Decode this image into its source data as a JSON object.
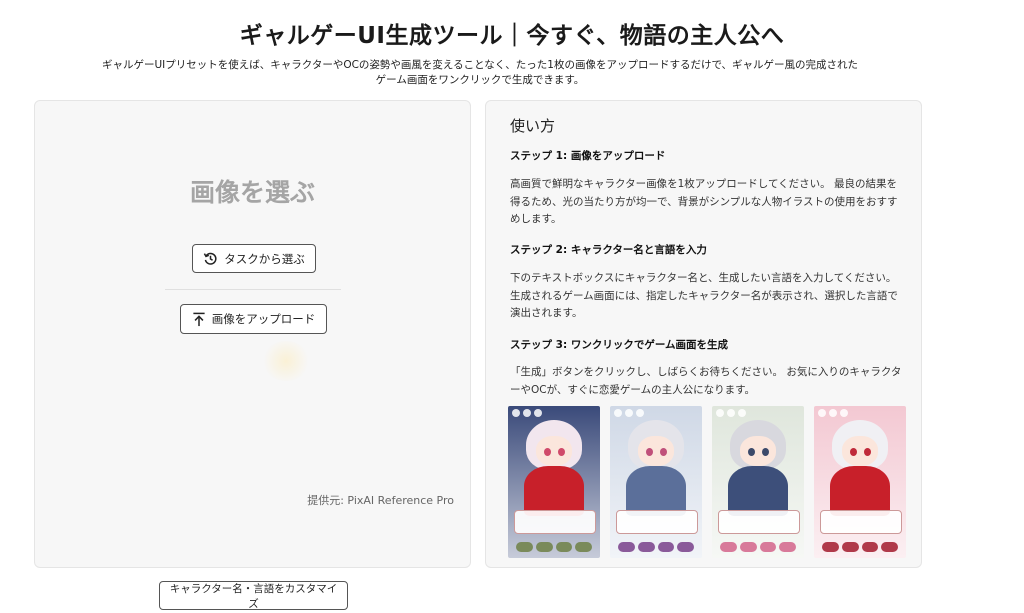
{
  "header": {
    "title": "ギャルゲーUI生成ツール｜今すぐ、物語の主人公へ",
    "subtitle": "ギャルゲーUIプリセットを使えば、キャラクターやOCの姿勢や画風を変えることなく、たった1枚の画像をアップロードするだけで、ギャルゲー風の完成されたゲーム画面をワンクリックで生成できます。"
  },
  "upload_panel": {
    "heading": "画像を選ぶ",
    "task_button": "タスクから選ぶ",
    "upload_button": "画像をアップロード",
    "credit": "提供元: PixAI Reference Pro"
  },
  "howto": {
    "title": "使い方",
    "steps": [
      {
        "heading": "ステップ 1:  画像をアップロード",
        "body": "高画質で鮮明なキャラクター画像を1枚アップロードしてください。 最良の結果を得るため、光の当たり方が均一で、背景がシンプルな人物イラストの使用をおすすめします。"
      },
      {
        "heading": "ステップ 2:  キャラクター名と言語を入力",
        "body": "下のテキストボックスにキャラクター名と、生成したい言語を入力してください。生成されるゲーム画面には、指定したキャラクター名が表示され、選択した言語で演出されます。"
      },
      {
        "heading": "ステップ 3:  ワンクリックでゲーム画面を生成",
        "body": "「生成」ボタンをクリックし、しばらくお待ちください。 お気に入りのキャラクターやOCが、すぐに恋愛ゲームの主人公になります。"
      }
    ],
    "examples": [
      {
        "name": "example-santa-girl",
        "bg": "#3a4a7a",
        "hair": "#f2e6ee",
        "eye": "#d04a6a",
        "body": "#c8202a",
        "opt": "#7a8a5a"
      },
      {
        "name": "example-silver-hair-girl",
        "bg": "#cfd8e6",
        "hair": "#e4e4ea",
        "eye": "#c0507a",
        "body": "#5b6f9a",
        "opt": "#8a5a9a"
      },
      {
        "name": "example-cat-ear-girl",
        "bg": "#dfe6dc",
        "hair": "#d8d8de",
        "eye": "#3c4a6a",
        "body": "#3d4f7a",
        "opt": "#d87a9a"
      },
      {
        "name": "example-red-hood-girl",
        "bg": "#f3c8d2",
        "hair": "#f0f0f4",
        "eye": "#c02a3a",
        "body": "#c8202a",
        "opt": "#b03a4a"
      }
    ]
  },
  "footer": {
    "customize_button": "キャラクター名・言語をカスタマイズ"
  }
}
